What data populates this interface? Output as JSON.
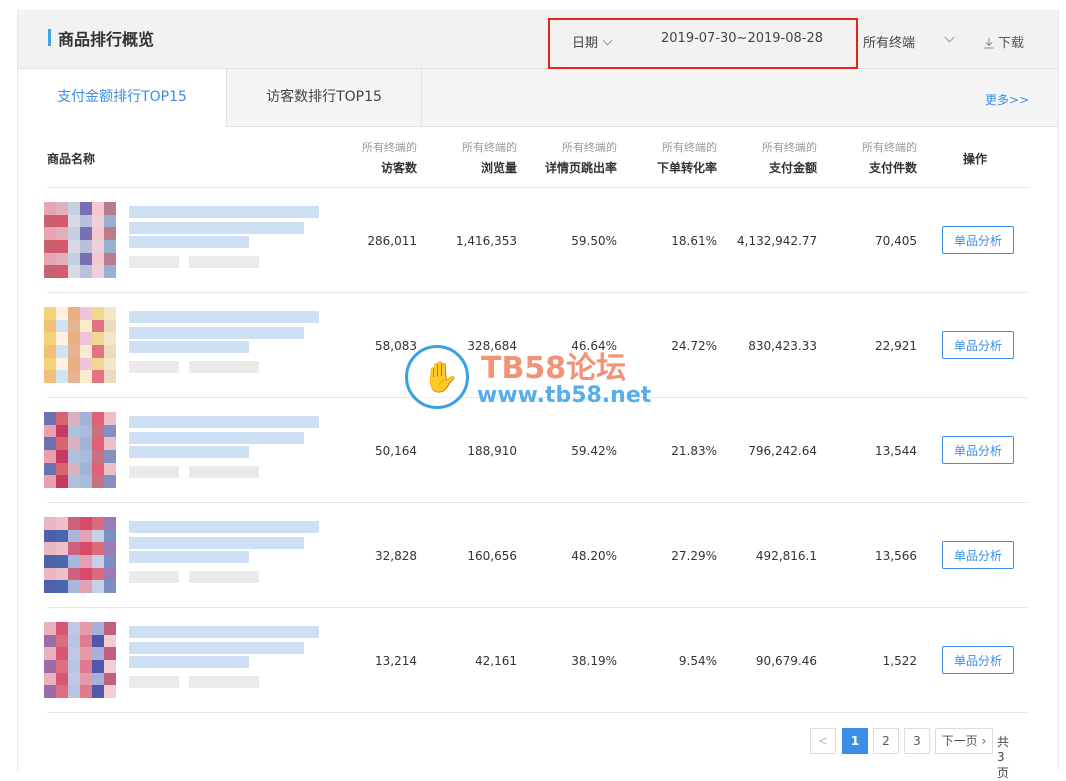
{
  "header": {
    "title": "商品排行概览",
    "date_label": "日期",
    "date_range": "2019-07-30~2019-08-28",
    "terminal_label": "所有终端",
    "download_label": "下载",
    "highlight_color": "#e1251b"
  },
  "tabs": [
    {
      "label": "支付金额排行TOP15",
      "active": true
    },
    {
      "label": "访客数排行TOP15",
      "active": false
    }
  ],
  "more_label": "更多>>",
  "columns": {
    "name": "商品名称",
    "visitors": {
      "sub": "所有终端的",
      "main": "访客数"
    },
    "pageviews": {
      "sub": "所有终端的",
      "main": "浏览量"
    },
    "bounce": {
      "sub": "所有终端的",
      "main": "详情页跳出率"
    },
    "conversion": {
      "sub": "所有终端的",
      "main": "下单转化率"
    },
    "amount": {
      "sub": "所有终端的",
      "main": "支付金额"
    },
    "items": {
      "sub": "所有终端的",
      "main": "支付件数"
    },
    "action": "操作"
  },
  "rows": [
    {
      "visitors": "286,011",
      "pageviews": "1,416,353",
      "bounce": "59.50%",
      "conversion": "18.61%",
      "amount": "4,132,942.77",
      "items": "70,405",
      "action": "单品分析"
    },
    {
      "visitors": "58,083",
      "pageviews": "328,684",
      "bounce": "46.64%",
      "conversion": "24.72%",
      "amount": "830,423.33",
      "items": "22,921",
      "action": "单品分析"
    },
    {
      "visitors": "50,164",
      "pageviews": "188,910",
      "bounce": "59.42%",
      "conversion": "21.83%",
      "amount": "796,242.64",
      "items": "13,544",
      "action": "单品分析"
    },
    {
      "visitors": "32,828",
      "pageviews": "160,656",
      "bounce": "48.20%",
      "conversion": "27.29%",
      "amount": "492,816.1",
      "items": "13,566",
      "action": "单品分析"
    },
    {
      "visitors": "13,214",
      "pageviews": "42,161",
      "bounce": "38.19%",
      "conversion": "9.54%",
      "amount": "90,679.46",
      "items": "1,522",
      "action": "单品分析"
    }
  ],
  "pagination": {
    "prev": "<",
    "pages": [
      "1",
      "2",
      "3"
    ],
    "current": "1",
    "next": "下一页",
    "total": "共3页"
  },
  "watermark": {
    "title": "TB58论坛",
    "url": "www.tb58.net"
  },
  "colors": {
    "accent": "#3a8ee6",
    "title_bar": "#3fa6e0"
  }
}
